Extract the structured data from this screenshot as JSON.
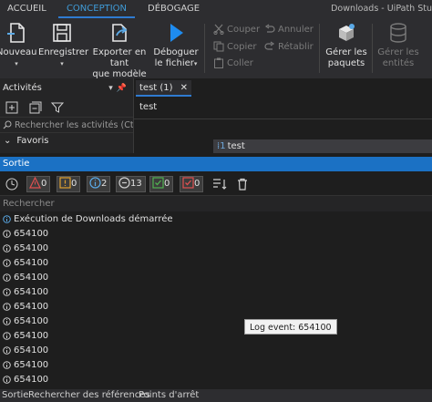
{
  "tabs": [
    {
      "label": "ACCUEIL",
      "active": false
    },
    {
      "label": "CONCEPTION",
      "active": true
    },
    {
      "label": "DÉBOGAGE",
      "active": false
    }
  ],
  "window_title": "Downloads - UiPath Stu",
  "ribbon": {
    "nouveau": "Nouveau",
    "enregistrer": "Enregistrer",
    "exporter_line1": "Exporter en tant",
    "exporter_line2": "que modèle",
    "deboguer_line1": "Déboguer",
    "deboguer_line2": "le fichier",
    "couper": "Couper",
    "copier": "Copier",
    "coller": "Coller",
    "annuler": "Annuler",
    "retablir": "Rétablir",
    "gerer_paquets_line1": "Gérer les",
    "gerer_paquets_line2": "paquets",
    "gerer_entites_line1": "Gérer les",
    "gerer_entites_line2": "entités"
  },
  "activities": {
    "title": "Activités",
    "search_placeholder": "Rechercher les activités (Ctrl+",
    "favoris": "Favoris"
  },
  "designer": {
    "tab_label": "test (1)",
    "breadcrumb": "test",
    "activity_label": "test",
    "activity_badge": "1"
  },
  "output": {
    "title": "Sortie",
    "filters": [
      {
        "kind": "error",
        "count": "0"
      },
      {
        "kind": "warning",
        "count": "0"
      },
      {
        "kind": "info",
        "count": "2"
      },
      {
        "kind": "trace",
        "count": "13"
      },
      {
        "kind": "success",
        "count": "0"
      },
      {
        "kind": "failed",
        "count": "0"
      }
    ],
    "search_placeholder": "Rechercher",
    "rows": [
      "Exécution de Downloads démarrée",
      "654100",
      "654100",
      "654100",
      "654100",
      "654100",
      "654100",
      "654100",
      "654100",
      "654100",
      "654100",
      "654100"
    ],
    "tooltip": "Log event: 654100"
  },
  "bottom_tabs": [
    "Sortie",
    "Rechercher des références",
    "Points d'arrêt"
  ],
  "colors": {
    "accent": "#2f7bd1",
    "panel_title": "#1b71c4",
    "background": "#1e1e1e"
  }
}
